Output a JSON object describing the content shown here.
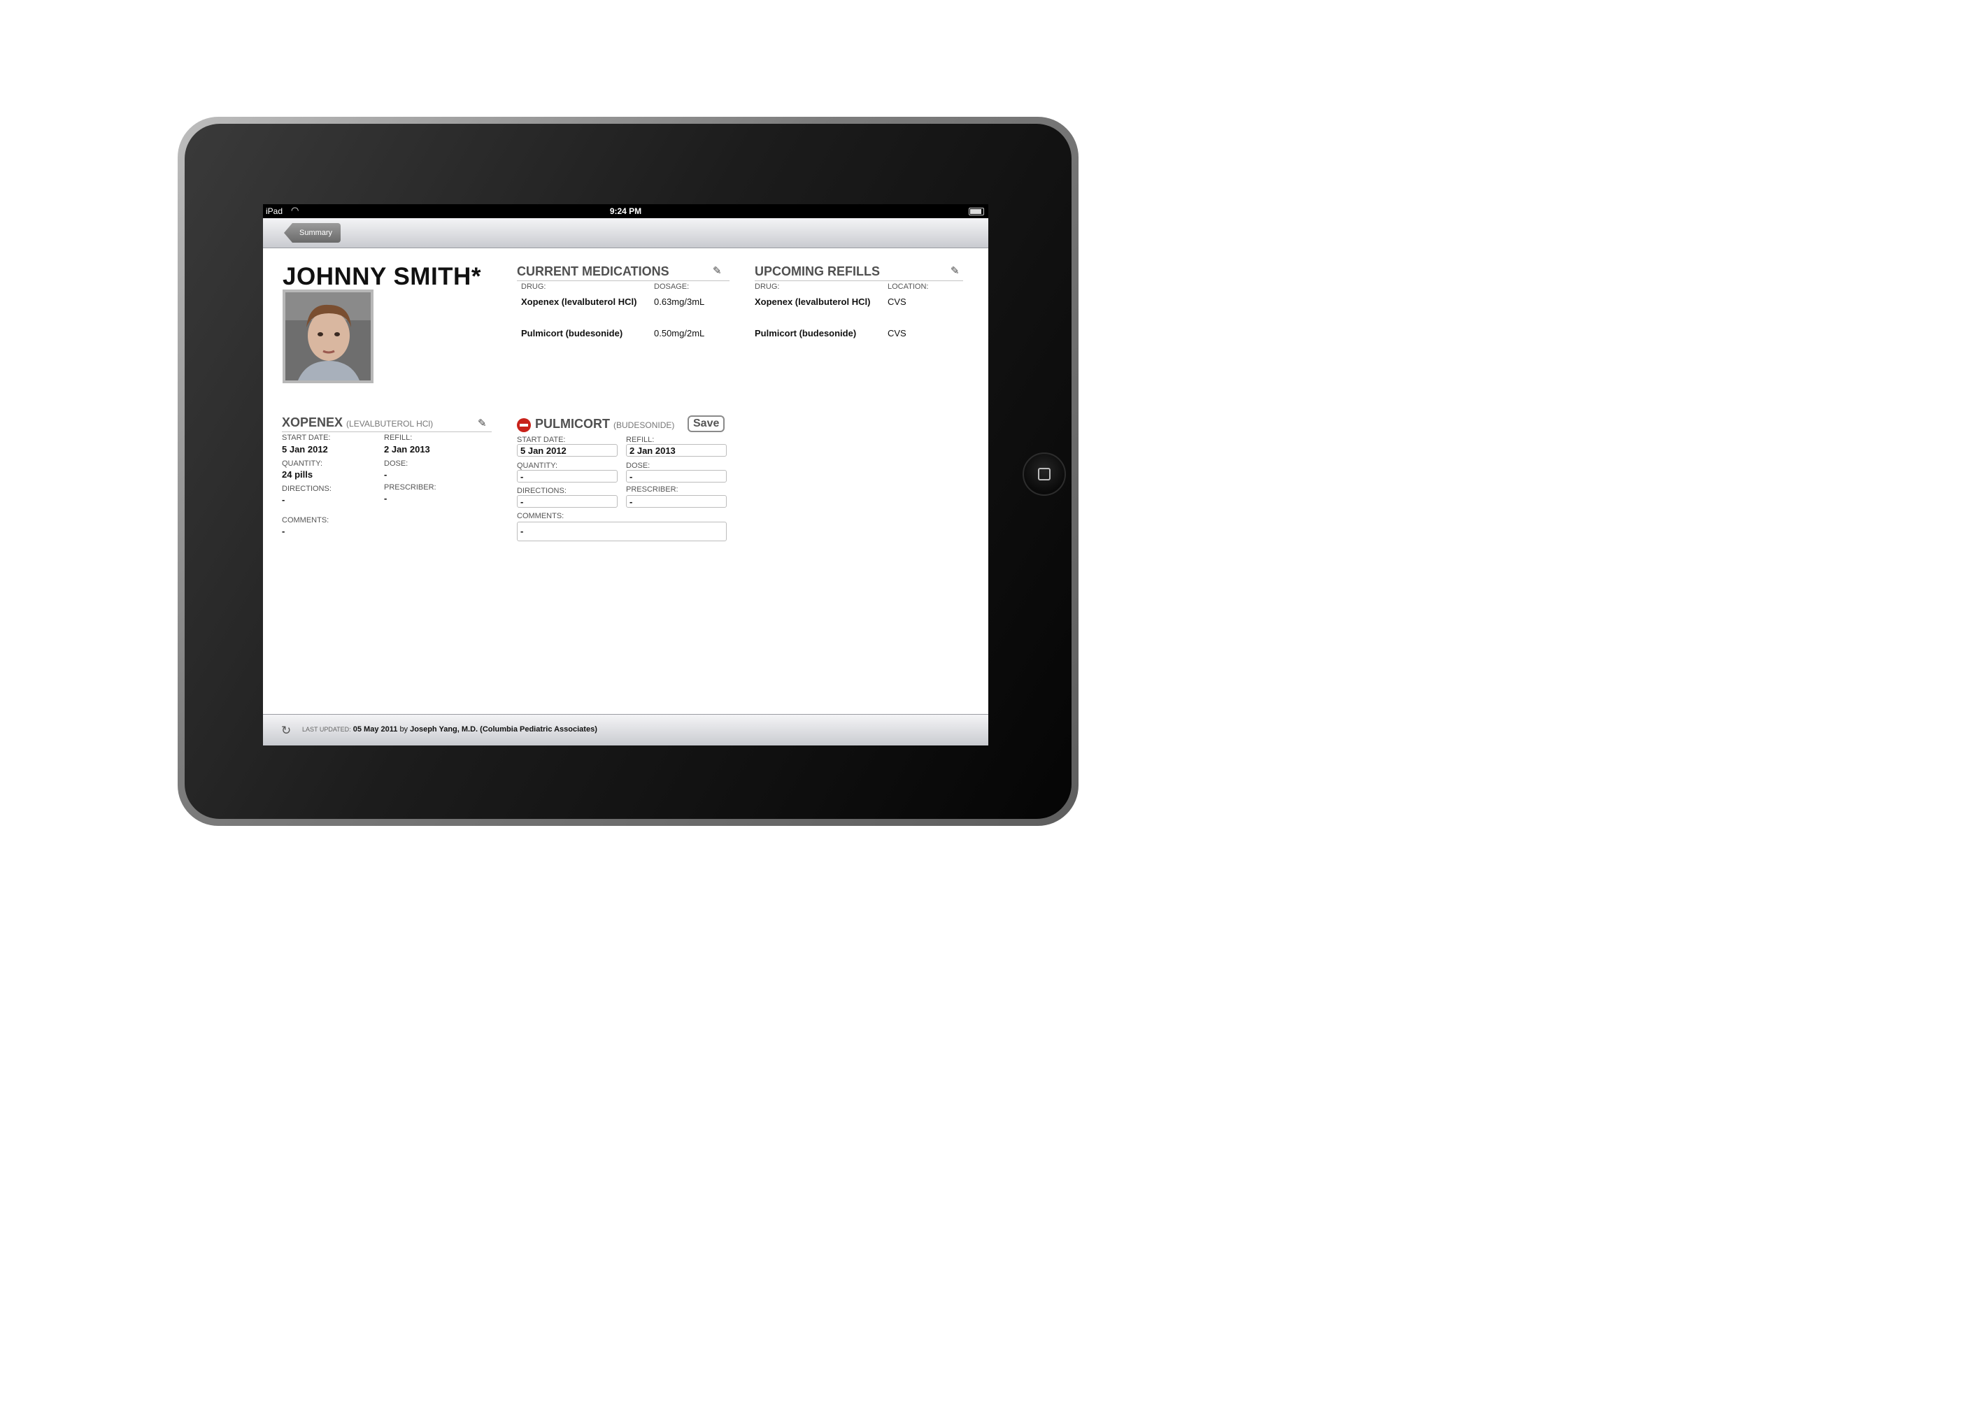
{
  "statusbar": {
    "carrier": "iPad",
    "time": "9:24 PM"
  },
  "navbar": {
    "back_label": "Summary"
  },
  "patient": {
    "name": "JOHNNY SMITH*"
  },
  "current_medications": {
    "title": "CURRENT MEDICATIONS",
    "col_drug": "DRUG:",
    "col_dosage": "DOSAGE:",
    "rows": [
      {
        "drug": "Xopenex (levalbuterol HCl)",
        "dosage": "0.63mg/3mL"
      },
      {
        "drug": "Pulmicort (budesonide)",
        "dosage": "0.50mg/2mL"
      }
    ]
  },
  "upcoming_refills": {
    "title": "UPCOMING REFILLS",
    "col_drug": "DRUG:",
    "col_location": "LOCATION:",
    "rows": [
      {
        "drug": "Xopenex (levalbuterol HCl)",
        "location": "CVS"
      },
      {
        "drug": "Pulmicort (budesonide)",
        "location": "CVS"
      }
    ]
  },
  "xopenex": {
    "title": "XOPENEX",
    "subtitle": "(LEVALBUTEROL HCl)",
    "start_label": "START DATE:",
    "start": "5 Jan 2012",
    "refill_label": "REFILL:",
    "refill": "2 Jan 2013",
    "quantity_label": "QUANTITY:",
    "quantity": "24 pills",
    "dose_label": "DOSE:",
    "dose": "-",
    "directions_label": "DIRECTIONS:",
    "directions": "-",
    "prescriber_label": "PRESCRIBER:",
    "prescriber": "-",
    "comments_label": "COMMENTS:",
    "comments": "-"
  },
  "pulmicort": {
    "title": "PULMICORT",
    "subtitle": "(BUDESONIDE)",
    "save_label": "Save",
    "start_label": "START DATE:",
    "start": "5 Jan 2012",
    "refill_label": "REFILL:",
    "refill": "2 Jan 2013",
    "quantity_label": "QUANTITY:",
    "quantity": "-",
    "dose_label": "DOSE:",
    "dose": "-",
    "directions_label": "DIRECTIONS:",
    "directions": "-",
    "prescriber_label": "PRESCRIBER:",
    "prescriber": "-",
    "comments_label": "COMMENTS:",
    "comments": "-"
  },
  "footer": {
    "last_updated_label": "LAST UPDATED:",
    "date": "05 May 2011",
    "by": "by",
    "author": "Joseph Yang, M.D. (Columbia Pediatric Associates)"
  },
  "icons": {
    "pencil": "pencil-icon",
    "delete": "delete-icon",
    "refresh": "refresh-icon",
    "wifi": "wifi-icon",
    "battery": "battery-icon",
    "home": "home-button-icon"
  },
  "colors": {
    "delete_red": "#c8221a",
    "navbar_top": "#f4f4f6",
    "navbar_bottom": "#c9cbd0"
  }
}
